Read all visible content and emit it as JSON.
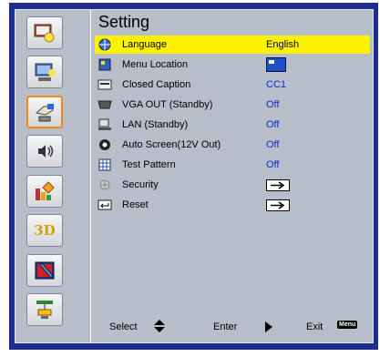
{
  "title": "Setting",
  "sidebar": {
    "items": [
      {
        "icon": "image-settings-icon",
        "active": false
      },
      {
        "icon": "display-settings-icon",
        "active": false
      },
      {
        "icon": "setup-hand-icon",
        "active": true
      },
      {
        "icon": "volume-icon",
        "active": false
      },
      {
        "icon": "options-icon",
        "active": false
      },
      {
        "icon": "3d-icon",
        "label": "3D",
        "active": false
      },
      {
        "icon": "interactive-pen-icon",
        "active": false
      },
      {
        "icon": "lan-settings-icon",
        "active": false
      }
    ]
  },
  "menu": [
    {
      "label": "Language",
      "value": "English",
      "icon": "globe-icon",
      "selected": true
    },
    {
      "label": "Menu Location",
      "value": "",
      "icon": "grid-icon",
      "swatch": true
    },
    {
      "label": "Closed Caption",
      "value": "CC1",
      "icon": "caption-icon"
    },
    {
      "label": "VGA OUT (Standby)",
      "value": "Off",
      "icon": "vga-icon"
    },
    {
      "label": "LAN (Standby)",
      "value": "Off",
      "icon": "lan-icon"
    },
    {
      "label": "Auto Screen(12V Out)",
      "value": "Off",
      "icon": "gear-icon"
    },
    {
      "label": "Test Pattern",
      "value": "Off",
      "icon": "pattern-icon"
    },
    {
      "label": "Security",
      "value": "",
      "icon": "security-icon",
      "arrow": true
    },
    {
      "label": "Reset",
      "value": "",
      "icon": "reset-icon",
      "arrow": true
    }
  ],
  "footer": {
    "select": "Select",
    "enter": "Enter",
    "exit": "Exit",
    "menu_key": "Menu"
  },
  "colors": {
    "frame": "#1d2f8e",
    "panel": "#b7bdc9",
    "highlight": "#fff200",
    "value": "#0a2cd8",
    "active_border": "#f08a10"
  }
}
